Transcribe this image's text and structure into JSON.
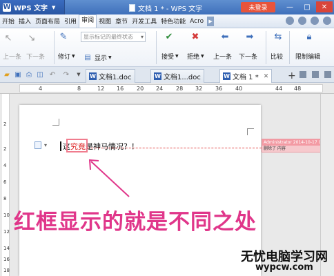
{
  "app": {
    "name": "WPS 文字",
    "window_title": "文档 1 * - WPS 文字",
    "login_label": "未登录"
  },
  "menu": {
    "items": [
      "开始",
      "插入",
      "页面布局",
      "引用",
      "审阅",
      "视图",
      "章节",
      "开发工具",
      "特色功能",
      "Acro"
    ],
    "active": "审阅"
  },
  "ribbon": {
    "prev_label": "上一条",
    "next_label": "下一条",
    "track_dropdown": "显示标记的最终状态",
    "revise_label": "修订",
    "show_label": "显示",
    "accept_label": "接受",
    "reject_label": "拒绝",
    "prev_change_label": "上一条",
    "next_change_label": "下一条",
    "compare_label": "比较",
    "restrict_label": "限制编辑"
  },
  "tabs": [
    {
      "label": "文档1.doc",
      "active": false
    },
    {
      "label": "文档1...doc",
      "active": false
    },
    {
      "label": "文档 1 *",
      "active": true
    }
  ],
  "ruler": {
    "h_ticks": [
      "4",
      "8",
      "12",
      "16",
      "20",
      "24",
      "28",
      "32",
      "36",
      "40",
      "44",
      "48"
    ],
    "v_ticks": [
      "2",
      "2",
      "4",
      "6",
      "8",
      "10",
      "12",
      "14",
      "16",
      "18"
    ]
  },
  "document": {
    "prefix": "这",
    "deleted_text": "究竟",
    "suffix": "是神马情况？！"
  },
  "revision": {
    "header": "Administrator 2014-10-17 09:",
    "body": "删除了 内容"
  },
  "annotation_text": "红框显示的就是不同之处",
  "watermark": {
    "title": "无忧电脑学习网",
    "url": "wypcw.com"
  }
}
